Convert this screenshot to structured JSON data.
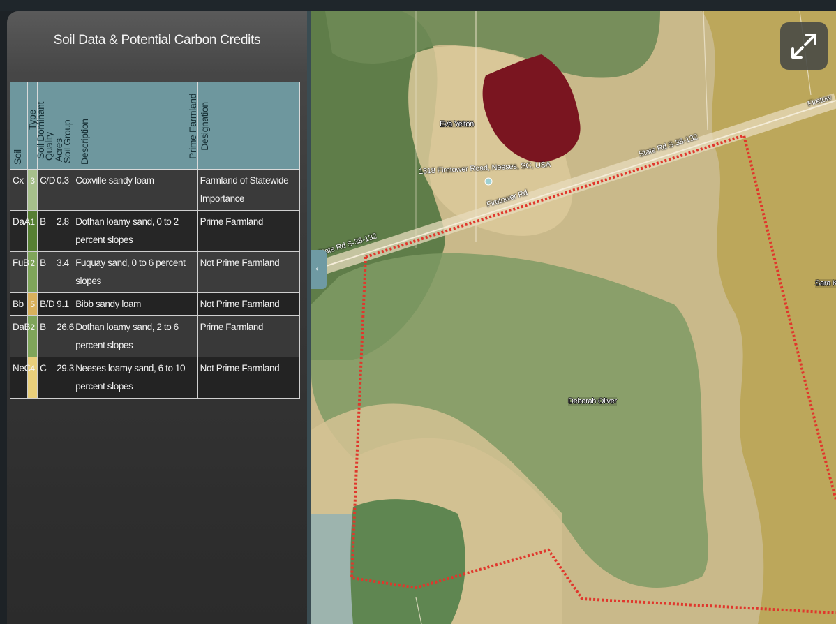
{
  "panel": {
    "title": "Soil Data & Potential Carbon Credits",
    "headers": {
      "soil": "Soil",
      "type": "Type",
      "dominant_soil": "Soil Dominant",
      "quality": "Quality",
      "acres": "Acres",
      "soil_group": "Soil Group",
      "description": "Description",
      "farmland": "Prime Farmland Designation"
    },
    "rows": [
      {
        "soil": "Cx",
        "type": "3",
        "type_color": "#a7c08c",
        "group": "C/D",
        "acres": "0.3",
        "description": "Coxville sandy loam",
        "farmland": "Farmland of Statewide Importance"
      },
      {
        "soil": "DaA",
        "type": "1",
        "type_color": "#577f33",
        "group": "B",
        "acres": "2.8",
        "description": "Dothan loamy sand, 0 to 2 percent slopes",
        "farmland": "Prime Farmland"
      },
      {
        "soil": "FuB",
        "type": "2",
        "type_color": "#7fa55a",
        "group": "B",
        "acres": "3.4",
        "description": "Fuquay sand, 0 to 6 percent slopes",
        "farmland": "Not Prime Farmland"
      },
      {
        "soil": "Bb",
        "type": "5",
        "type_color": "#d8b15c",
        "group": "B/D",
        "acres": "9.1",
        "description": "Bibb sandy loam",
        "farmland": "Not Prime Farmland"
      },
      {
        "soil": "DaB",
        "type": "2",
        "type_color": "#7fa55a",
        "group": "B",
        "acres": "26.6",
        "description": "Dothan loamy sand, 2 to 6 percent slopes",
        "farmland": "Prime Farmland"
      },
      {
        "soil": "NeC",
        "type": "4",
        "type_color": "#e9cf7b",
        "group": "C",
        "acres": "29.3",
        "description": "Neeses loamy sand, 6 to 10 percent slopes",
        "farmland": "Not Prime Farmland"
      }
    ]
  },
  "map": {
    "owner_1": "Eva Yelton",
    "owner_2": "Deborah Oliver",
    "owner_3": "Sara K",
    "address": "1318 Firetower Road, Neeses, SC, USA",
    "road_1": "State Rd S-38-132",
    "road_2": "Firetower Rd",
    "road_3": "State Rd S-38-132",
    "road_4": "Firetow",
    "boundary_color": "#e0372c"
  },
  "icons": {
    "collapse": "arrow-left-icon",
    "expand": "expand-icon"
  }
}
